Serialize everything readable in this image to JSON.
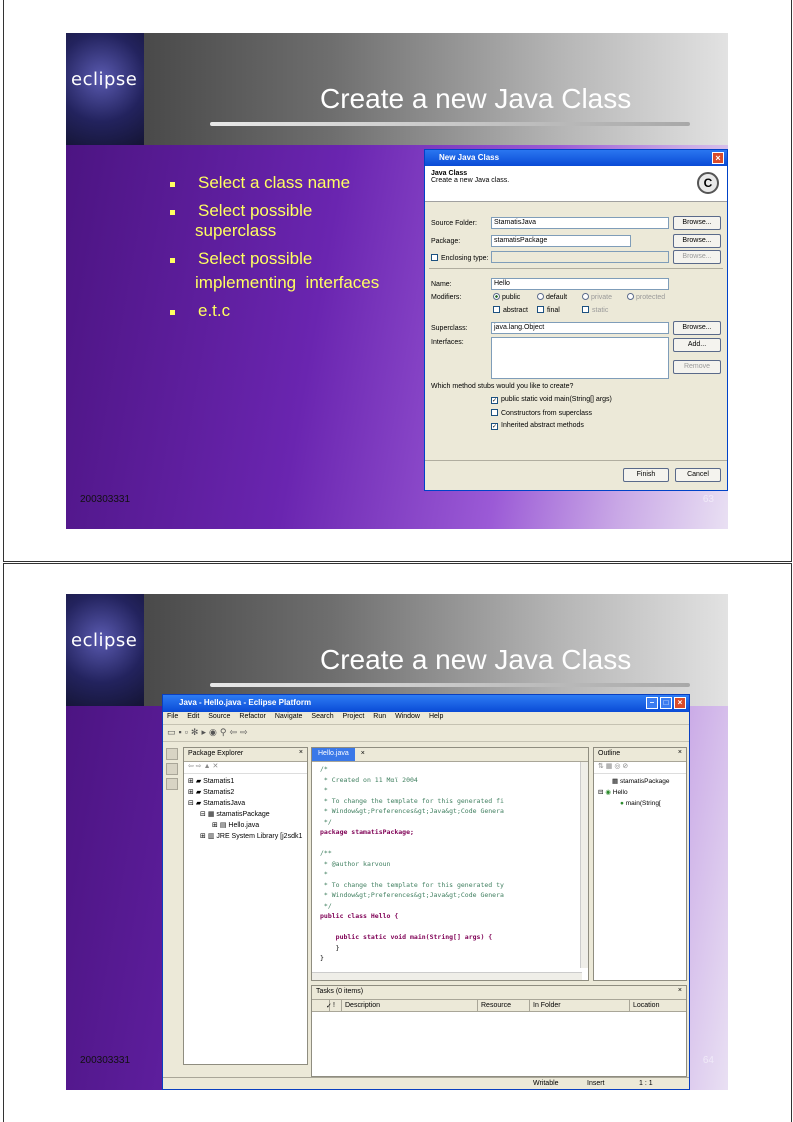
{
  "slide1": {
    "logo_text": "eclipse",
    "title": "Create a new Java Class",
    "bullets": [
      {
        "line1": "Select a class name",
        "line2": ""
      },
      {
        "line1": "Select possible",
        "line2": "superclass"
      },
      {
        "line1": "Select possible",
        "line2": "implementing  interfaces"
      },
      {
        "line1": "e.t.c",
        "line2": ""
      }
    ],
    "footer_left": "200303331",
    "page_number": "63",
    "dialog": {
      "title": "New Java Class",
      "header_title": "Java Class",
      "header_desc": "Create a new Java class.",
      "source_folder_label": "Source Folder:",
      "source_folder_value": "StamatisJava",
      "package_label": "Package:",
      "package_value": "stamatisPackage",
      "enclosing_label": "Enclosing type:",
      "name_label": "Name:",
      "name_value": "Hello",
      "modifiers_label": "Modifiers:",
      "mod_public": "public",
      "mod_default": "default",
      "mod_private": "private",
      "mod_protected": "protected",
      "mod_abstract": "abstract",
      "mod_final": "final",
      "mod_static": "static",
      "superclass_label": "Superclass:",
      "superclass_value": "java.lang.Object",
      "interfaces_label": "Interfaces:",
      "browse": "Browse...",
      "add": "Add...",
      "remove": "Remove",
      "stubs_question": "Which method stubs would you like to create?",
      "stub_main": "public static void main(String[] args)",
      "stub_ctors": "Constructors from superclass",
      "stub_inherited": "Inherited abstract methods",
      "finish": "Finish",
      "cancel": "Cancel"
    }
  },
  "slide2": {
    "logo_text": "eclipse",
    "title": "Create a new Java Class",
    "footer_left": "200303331",
    "page_number": "64",
    "window": {
      "title": "Java - Hello.java - Eclipse Platform",
      "menu": [
        "File",
        "Edit",
        "Source",
        "Refactor",
        "Navigate",
        "Search",
        "Project",
        "Run",
        "Window",
        "Help"
      ],
      "package_explorer_title": "Package Explorer",
      "tree": [
        "Stamatis1",
        "Stamatis2",
        "StamatisJava",
        "stamatisPackage",
        "Hello.java",
        "JRE System Library [j2sdk1"
      ],
      "editor_tab": "Hello.java",
      "code": [
        "/*",
        " * Created on 11 Μαϊ 2004",
        " *",
        " * To change the template for this generated fi",
        " * Window&gt;Preferences&gt;Java&gt;Code Genera",
        " */",
        "package stamatisPackage;",
        "",
        "/**",
        " * @author karvoun",
        " *",
        " * To change the template for this generated ty",
        " * Window&gt;Preferences&gt;Java&gt;Code Genera",
        " */",
        "public class Hello {",
        "",
        "    public static void main(String[] args) {",
        "    }",
        "}"
      ],
      "outline_title": "Outline",
      "outline_items": [
        "stamatisPackage",
        "Hello",
        "main(String["
      ],
      "tasks_title": "Tasks (0 items)",
      "tasks_columns": [
        "✓",
        "!",
        "Description",
        "Resource",
        "In Folder",
        "Location"
      ],
      "status_writable": "Writable",
      "status_insert": "Insert",
      "status_pos": "1 : 1"
    }
  }
}
